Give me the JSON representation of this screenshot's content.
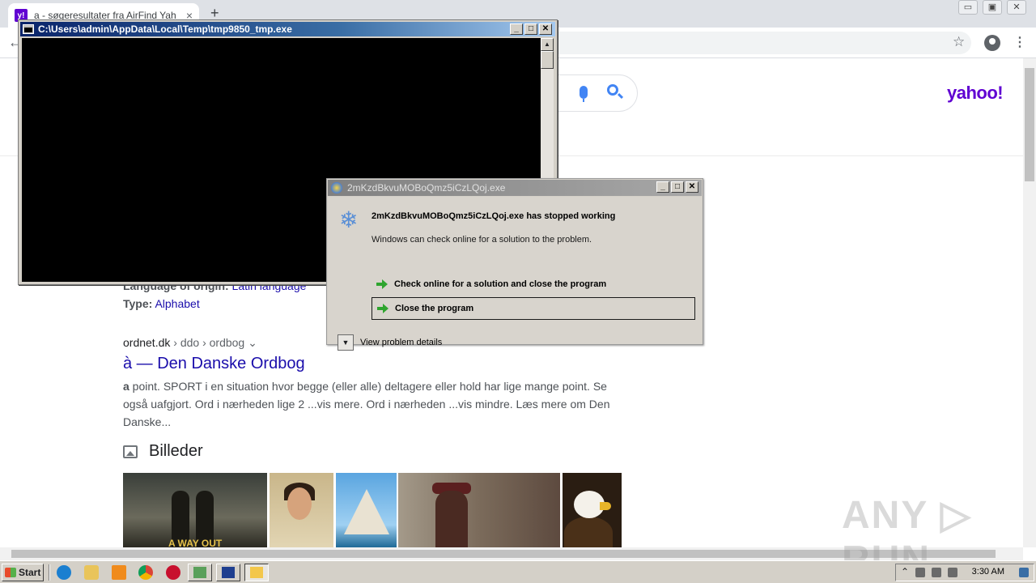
{
  "browser": {
    "tab_title": "a - søgeresultater fra AirFind Yahoo",
    "tab_favicon_text": "y!",
    "tab_close_glyph": "×",
    "new_tab_glyph": "+",
    "window_controls": [
      "▭",
      "▣",
      "✕"
    ],
    "back_glyph": "←",
    "star_glyph": "☆",
    "menu_glyph": "⋮",
    "brand_color": "#6001d2"
  },
  "page": {
    "logo": "yahoo!",
    "lang_line": {
      "label": "Language of origin:",
      "value": "Latin language"
    },
    "type_line": {
      "label": "Type:",
      "value": "Alphabet"
    },
    "result": {
      "site": "ordnet.dk",
      "crumbs": " › ddo › ordbog ⌄",
      "title": "à — Den Danske Ordbog",
      "snippet_bold": "a",
      "snippet": " point. SPORT i en situation hvor begge (eller alle) deltagere eller hold har lige mange point. Se også uafgjort. Ord i nærheden lige 2 ...vis mere. Ord i nærheden ...vis mindre. Læs mere om Den Danske..."
    },
    "images_heading": "Billeder",
    "image_thumb_caption": "A WAY OUT",
    "watermark": "ANY ▷ RUN"
  },
  "console_window": {
    "title": "C:\\Users\\admin\\AppData\\Local\\Temp\\tmp9850_tmp.exe",
    "controls": [
      "_",
      "□",
      "✕"
    ]
  },
  "error_dialog": {
    "title": "2mKzdBkvuMOBoQmz5iCzLQoj.exe",
    "heading": "2mKzdBkvuMOBoQmz5iCzLQoj.exe has stopped working",
    "subtext": "Windows can check online for a solution to the problem.",
    "option_check": "Check online for a solution and close the program",
    "option_close": "Close the program",
    "details_label": "View problem details",
    "controls": [
      "_",
      "□",
      "✕"
    ]
  },
  "taskbar": {
    "start_label": "Start",
    "clock": "3:30 AM",
    "tray_expand_glyph": "⌃"
  }
}
